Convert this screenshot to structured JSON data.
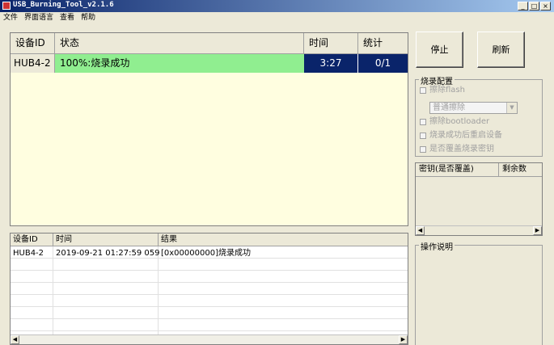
{
  "window": {
    "title": "USB_Burning_Tool_v2.1.6",
    "controls": [
      "_",
      "□",
      "×"
    ]
  },
  "menu": [
    "文件",
    "界面语言",
    "查看",
    "帮助"
  ],
  "device_table": {
    "headers": [
      "设备ID",
      "状态",
      "时间",
      "统计"
    ],
    "rows": [
      {
        "device_id": "HUB4-2",
        "status": "100%:烧录成功",
        "time": "3:27",
        "stats": "0/1"
      }
    ]
  },
  "log_table": {
    "headers": [
      "设备ID",
      "时间",
      "结果"
    ],
    "rows": [
      {
        "device_id": "HUB4-2",
        "time": "2019-09-21 01:27:59 059",
        "result": "[0x00000000]烧录成功"
      }
    ]
  },
  "buttons": {
    "stop": "停止",
    "refresh": "刷新"
  },
  "burn_config": {
    "title": "烧录配置",
    "erase_flash": "擦除flash",
    "erase_mode": "普通擦除",
    "erase_bootloader": "擦除bootloader",
    "reboot_after": "烧录成功后重启设备",
    "overwrite_key": "是否覆盖烧录密钥"
  },
  "key_table": {
    "headers": [
      "密钥(是否覆盖)",
      "剩余数"
    ]
  },
  "instructions": {
    "title": "操作说明"
  },
  "colors": {
    "status_success": "#90ee90",
    "time_stat_bg": "#0a246a",
    "panel_bg": "#fffee0"
  }
}
